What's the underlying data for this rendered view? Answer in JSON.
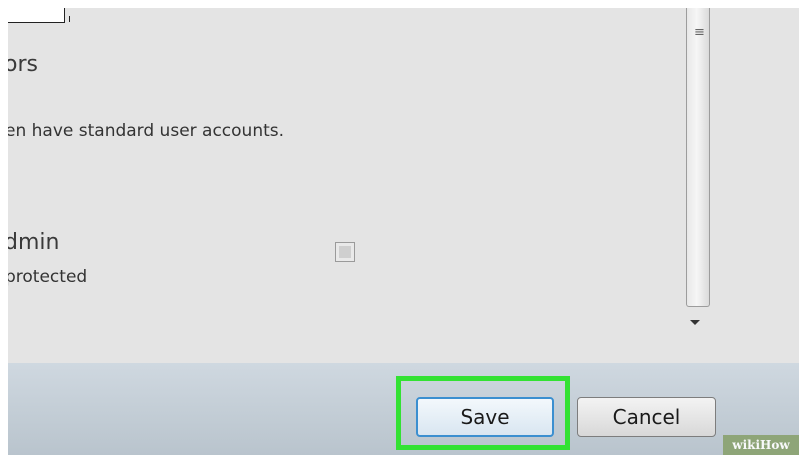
{
  "content": {
    "heading_fragment": "ors",
    "description_fragment": "en have standard user accounts.",
    "setting_name_fragment": "dmin",
    "setting_sub_fragment": "protected",
    "setting_checked": false
  },
  "footer": {
    "save_label": "Save",
    "cancel_label": "Cancel"
  },
  "watermark": "wikiHow",
  "colors": {
    "highlight": "#33e233",
    "save_border": "#3b8fd0",
    "footer_bg": "#c4ced6"
  }
}
